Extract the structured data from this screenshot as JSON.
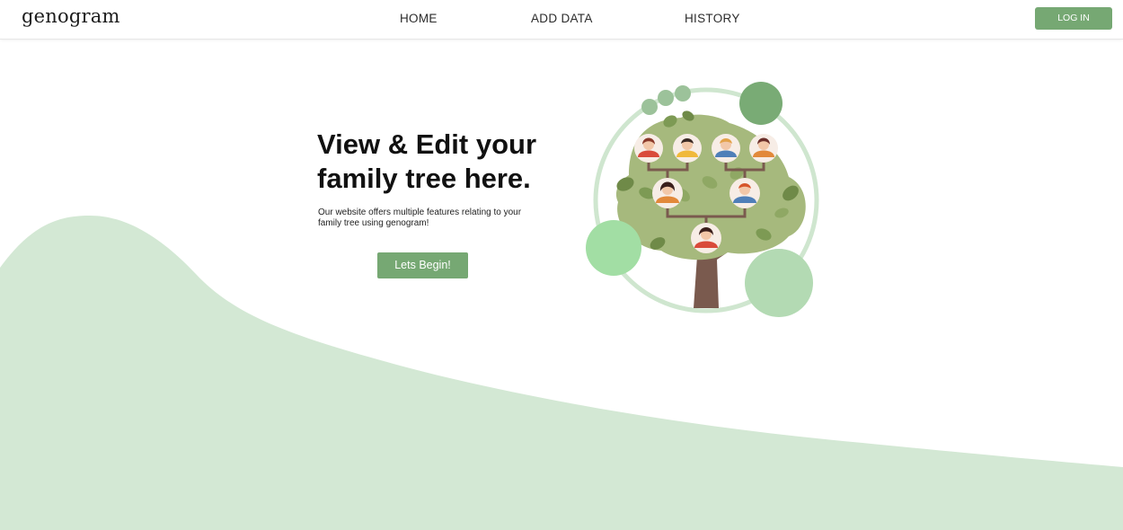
{
  "header": {
    "logo": "genogram",
    "nav": {
      "home": "HOME",
      "add_data": "ADD DATA",
      "history": "HISTORY"
    },
    "login_label": "LOG IN"
  },
  "hero": {
    "title_line1": "View & Edit your",
    "title_line2": "family tree here.",
    "description": "Our website offers multiple features relating to your family tree using genogram!",
    "cta_label": "Lets Begin!"
  },
  "colors": {
    "accent_green": "#76a873",
    "wave_green": "#d3e8d4",
    "tree_foliage": "#a6b97d",
    "tree_trunk": "#7a5a4e"
  },
  "icons": {
    "illustration": "family-tree-illustration"
  }
}
